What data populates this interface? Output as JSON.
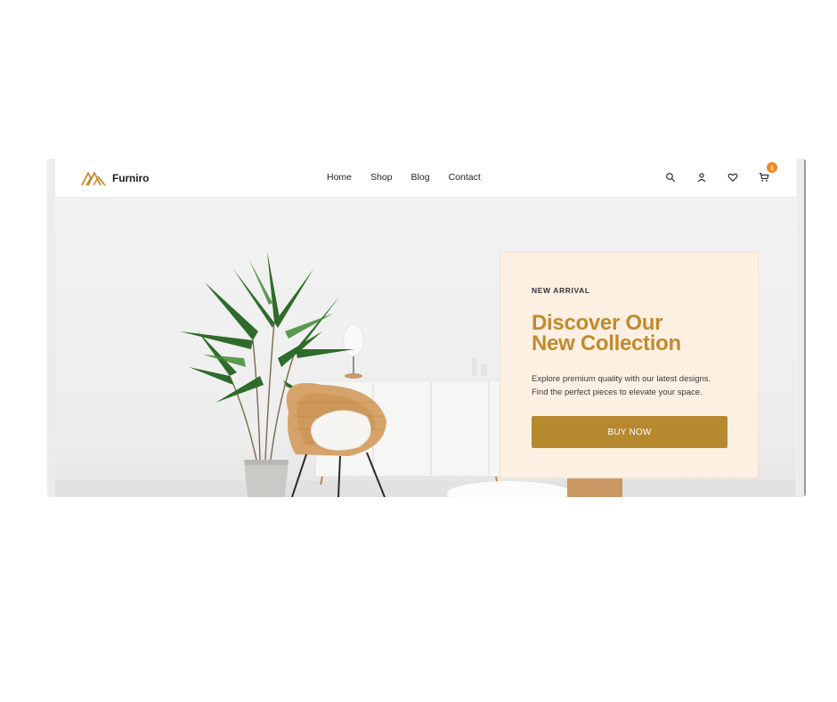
{
  "brand": {
    "name": "Furniro",
    "logo_icon": "furniro-logo-mark",
    "accent_color": "#c38a2b"
  },
  "nav": {
    "items": [
      {
        "label": "Home"
      },
      {
        "label": "Shop"
      },
      {
        "label": "Blog"
      },
      {
        "label": "Contact"
      }
    ]
  },
  "header_icons": {
    "search": "search-icon",
    "account": "user-icon",
    "wishlist": "heart-icon",
    "cart": "cart-icon",
    "cart_count": "1",
    "badge_color": "#f5871f"
  },
  "hero": {
    "eyebrow": "NEW ARRIVAL",
    "title": "Discover Our\nNew Collection",
    "description": "Explore premium quality with our latest designs.\nFind the perfect pieces to elevate your space.",
    "cta_label": "BUY NOW",
    "card_background": "#fdf0e3",
    "button_color": "#b7892f"
  }
}
